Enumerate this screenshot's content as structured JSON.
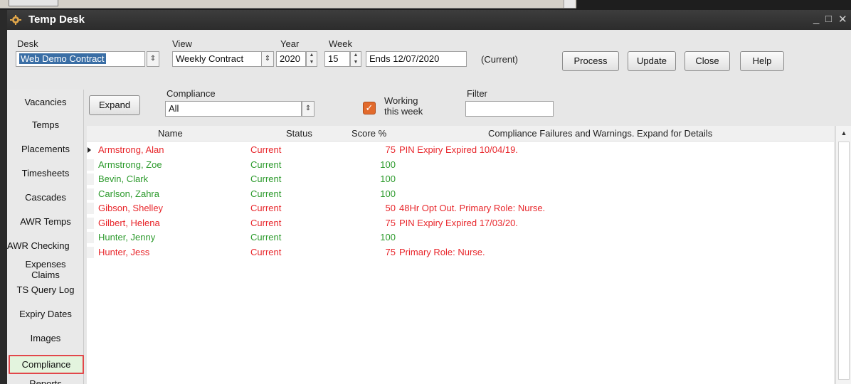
{
  "window": {
    "title": "Temp Desk",
    "minimize_glyph": "_",
    "maximize_glyph": "□",
    "close_glyph": "✕"
  },
  "toolbar": {
    "desk_label": "Desk",
    "desk_value": "Web Demo Contract",
    "view_label": "View",
    "view_value": "Weekly Contract",
    "year_label": "Year",
    "year_value": "2020",
    "week_label": "Week",
    "week_value": "15",
    "ends_value": "Ends 12/07/2020",
    "status_text": "(Current)",
    "process_label": "Process",
    "update_label": "Update",
    "close_label": "Close",
    "help_label": "Help"
  },
  "filters": {
    "expand_label": "Expand",
    "compliance_label": "Compliance",
    "compliance_value": "All",
    "working_label_line1": "Working",
    "working_label_line2": "this week",
    "working_checked": true,
    "filter_label": "Filter",
    "filter_value": ""
  },
  "sidebar": {
    "items": [
      {
        "label": "Vacancies"
      },
      {
        "label": "Temps"
      },
      {
        "label": "Placements"
      },
      {
        "label": "Timesheets"
      },
      {
        "label": "Cascades"
      },
      {
        "label": "AWR Temps"
      },
      {
        "label": "AWR Checking"
      },
      {
        "label": "Expenses Claims"
      },
      {
        "label": "TS Query Log"
      },
      {
        "label": "Expiry Dates"
      },
      {
        "label": "Images"
      },
      {
        "label": "Compliance",
        "active": true
      },
      {
        "label": "Reports"
      }
    ]
  },
  "table": {
    "columns": {
      "name": "Name",
      "status": "Status",
      "score": "Score %",
      "failures": "Compliance Failures and Warnings. Expand for Details"
    },
    "rows": [
      {
        "name": "Armstrong, Alan",
        "status": "Current",
        "score": "75",
        "failures": "PIN Expiry Expired 10/04/19.",
        "color": "#e8262b",
        "current": true
      },
      {
        "name": "Armstrong, Zoe",
        "status": "Current",
        "score": "100",
        "failures": "",
        "color": "#2c9a2c"
      },
      {
        "name": "Bevin, Clark",
        "status": "Current",
        "score": "100",
        "failures": "",
        "color": "#2c9a2c"
      },
      {
        "name": "Carlson, Zahra",
        "status": "Current",
        "score": "100",
        "failures": "",
        "color": "#2c9a2c"
      },
      {
        "name": "Gibson, Shelley",
        "status": "Current",
        "score": "50",
        "failures": "48Hr Opt Out. Primary Role: Nurse.",
        "color": "#e8262b"
      },
      {
        "name": "Gilbert, Helena",
        "status": "Current",
        "score": "75",
        "failures": "PIN Expiry Expired 17/03/20.",
        "color": "#e8262b"
      },
      {
        "name": "Hunter, Jenny",
        "status": "Current",
        "score": "100",
        "failures": "",
        "color": "#2c9a2c"
      },
      {
        "name": "Hunter, Jess",
        "status": "Current",
        "score": "75",
        "failures": "Primary Role: Nurse.",
        "color": "#e8262b"
      }
    ]
  },
  "icons": {
    "app": "temp-desk-app-icon",
    "check": "✓"
  }
}
